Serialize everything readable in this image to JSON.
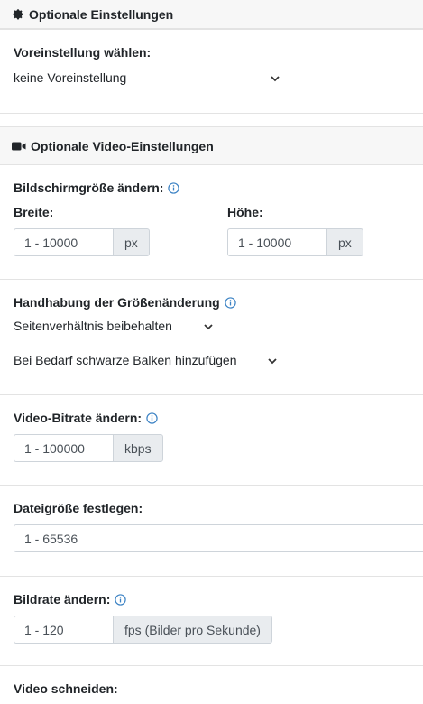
{
  "optional_settings": {
    "header": "Optionale Einstellungen",
    "preset_label": "Voreinstellung wählen:",
    "preset_value": "keine Voreinstellung"
  },
  "video_settings": {
    "header": "Optionale Video-Einstellungen",
    "screen_size": {
      "label": "Bildschirmgröße ändern:",
      "width_label": "Breite:",
      "width_placeholder": "1 - 10000",
      "width_unit": "px",
      "height_label": "Höhe:",
      "height_placeholder": "1 - 10000",
      "height_unit": "px"
    },
    "resize": {
      "label": "Handhabung der Größenänderung",
      "mode_value": "Seitenverhältnis beibehalten",
      "bars_value": "Bei Bedarf schwarze Balken hinzufügen"
    },
    "bitrate": {
      "label": "Video-Bitrate ändern:",
      "placeholder": "1 - 100000",
      "unit": "kbps"
    },
    "filesize": {
      "label": "Dateigröße festlegen:",
      "placeholder": "1 - 65536"
    },
    "framerate": {
      "label": "Bildrate ändern:",
      "placeholder": "1 - 120",
      "unit": "fps (Bilder pro Sekunde)"
    },
    "trim": {
      "label": "Video schneiden:"
    }
  },
  "colors": {
    "info_icon": "#3b82c4",
    "header_bg": "#f7f7f7",
    "addon_bg": "#e9ecef"
  }
}
